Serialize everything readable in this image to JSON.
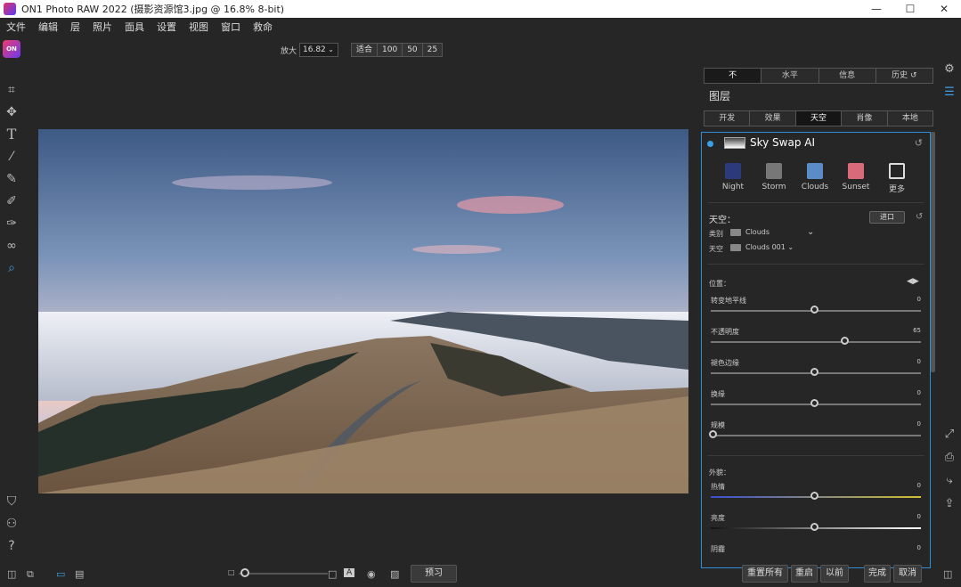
{
  "window": {
    "title": "ON1 Photo RAW 2022 (摄影资源馆3.jpg @ 16.8% 8-bit)",
    "min": "—",
    "max": "☐",
    "close": "✕"
  },
  "menu": [
    "文件",
    "编辑",
    "层",
    "照片",
    "面具",
    "设置",
    "视图",
    "窗口",
    "救命"
  ],
  "logo": "ON",
  "zoom": {
    "label": "放大",
    "value": "16.82",
    "buttons": [
      "适合",
      "100",
      "50",
      "25"
    ]
  },
  "panel": {
    "top_tabs": [
      "不",
      "水平",
      "信息",
      "历史"
    ],
    "title": "图层",
    "sub_tabs": [
      "开发",
      "效果",
      "天空",
      "肖像",
      "本地"
    ],
    "filter": {
      "name": "Sky Swap AI",
      "presets": [
        {
          "label": "Night",
          "color": "#2a3a7a"
        },
        {
          "label": "Storm",
          "color": "#777777"
        },
        {
          "label": "Clouds",
          "color": "#5a8cc8"
        },
        {
          "label": "Sunset",
          "color": "#d86a7a"
        },
        {
          "label": "更多",
          "color": "#dddddd"
        }
      ],
      "sky_section": "天空：",
      "import_button": "进口",
      "category_label": "类别",
      "category_value": "Clouds",
      "sky_label": "天空",
      "sky_value": "Clouds 001",
      "position_section": "位置：",
      "sliders": [
        {
          "label": "转变地平线",
          "value": "0",
          "pos": 0.5
        },
        {
          "label": "不透明度",
          "value": "65",
          "pos": 0.65
        },
        {
          "label": "褪色边缘",
          "value": "0",
          "pos": 0.5
        },
        {
          "label": "换缘",
          "value": "0",
          "pos": 0.5
        },
        {
          "label": "规模",
          "value": "0",
          "pos": 0.0
        }
      ],
      "look_section": "外貌：",
      "look_sliders": [
        {
          "label": "热情",
          "value": "0",
          "pos": 0.5
        },
        {
          "label": "亮度",
          "value": "0",
          "pos": 0.5
        },
        {
          "label": "阴霾",
          "value": "0",
          "pos": 0.5
        }
      ]
    }
  },
  "bottom": {
    "preview": "预习",
    "reset_all": "重置所有",
    "reset": "重启",
    "before": "以前",
    "done": "完成",
    "cancel": "取消",
    "a_label": "A"
  },
  "colors": {
    "accent": "#3aa0e8",
    "panel_bg": "#262626"
  }
}
